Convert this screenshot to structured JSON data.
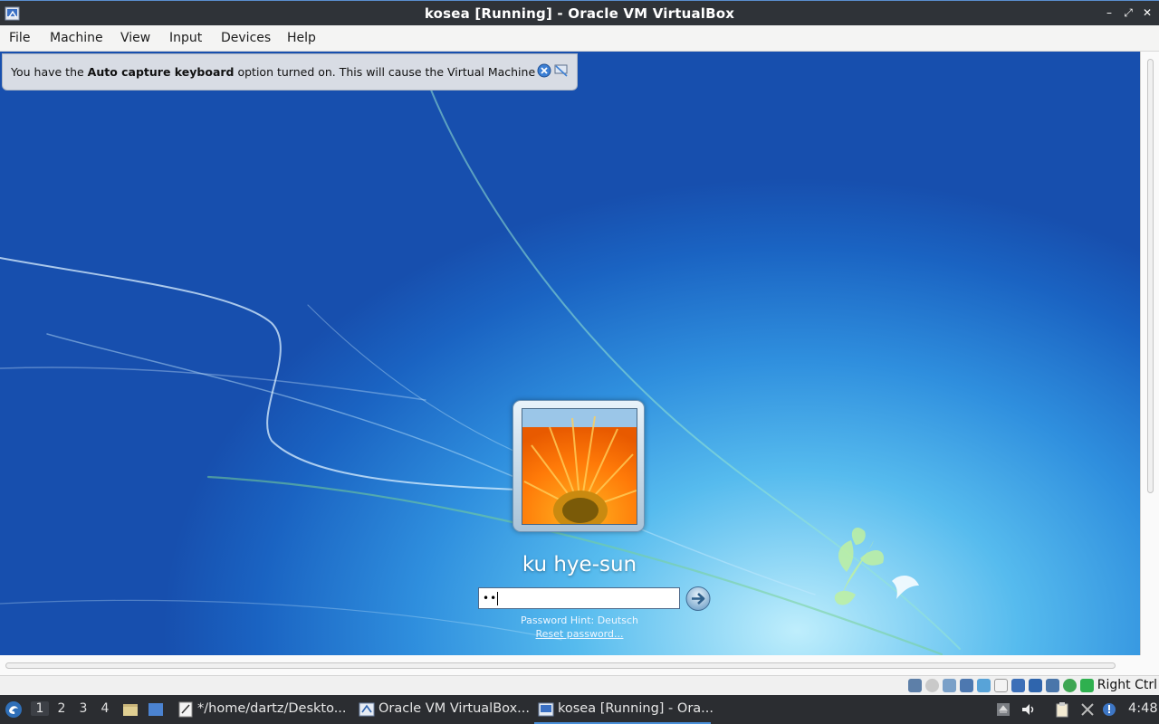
{
  "window": {
    "title": "kosea [Running] - Oracle VM VirtualBox",
    "controls": [
      "minimize",
      "maximize",
      "close"
    ]
  },
  "menu": {
    "items": [
      "File",
      "Machine",
      "View",
      "Input",
      "Devices",
      "Help"
    ]
  },
  "notification": {
    "text_before": "You have the ",
    "text_bold": "Auto capture keyboard",
    "text_after": " option turned on. This will cause the Virtual Machine to"
  },
  "login": {
    "username": "ku hye-sun",
    "password_masked": "••",
    "hint": "Password Hint: Deutsch",
    "reset": "Reset password..."
  },
  "statusbar": {
    "host_key": "Right Ctrl",
    "icons": [
      "hard-disk-icon",
      "optical-drive-icon",
      "audio-icon",
      "network-icon",
      "usb-icon",
      "shared-folders-icon",
      "display-icon",
      "video-capture-icon",
      "recording-icon",
      "vt-x-icon",
      "mouse-integration-icon"
    ]
  },
  "taskbar": {
    "workspaces": [
      "1",
      "2",
      "3",
      "4"
    ],
    "active_workspace": "1",
    "tasks": [
      {
        "label": "*/home/dartz/Deskto...",
        "icon": "text-editor-icon"
      },
      {
        "label": "Oracle VM VirtualBox...",
        "icon": "virtualbox-manager-icon"
      },
      {
        "label": "kosea [Running] - Ora...",
        "icon": "virtualbox-vm-icon",
        "active": true
      }
    ],
    "clock": "4:48"
  },
  "colors": {
    "accent": "#4a90d9",
    "titlebar": "#2f3338",
    "taskbar": "#2b2d31"
  }
}
